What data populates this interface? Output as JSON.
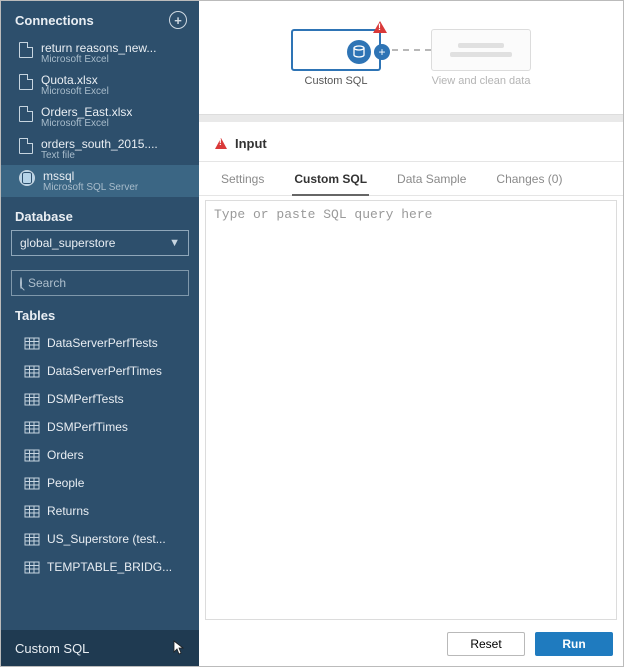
{
  "sidebar": {
    "connections_label": "Connections",
    "connections": [
      {
        "name": "return reasons_new...",
        "sub": "Microsoft Excel",
        "type": "file"
      },
      {
        "name": "Quota.xlsx",
        "sub": "Microsoft Excel",
        "type": "file"
      },
      {
        "name": "Orders_East.xlsx",
        "sub": "Microsoft Excel",
        "type": "file"
      },
      {
        "name": "orders_south_2015....",
        "sub": "Text file",
        "type": "file"
      },
      {
        "name": "mssql",
        "sub": "Microsoft SQL Server",
        "type": "db",
        "selected": true
      }
    ],
    "database_label": "Database",
    "database_value": "global_superstore",
    "search_placeholder": "Search",
    "tables_label": "Tables",
    "tables": [
      "DataServerPerfTests",
      "DataServerPerfTimes",
      "DSMPerfTests",
      "DSMPerfTimes",
      "Orders",
      "People",
      "Returns",
      "US_Superstore (test...",
      "TEMPTABLE_BRIDG..."
    ],
    "custom_sql_label": "Custom SQL"
  },
  "flow": {
    "node_label": "Custom SQL",
    "ghost_label": "View and clean data"
  },
  "panel": {
    "header": "Input",
    "tabs": [
      "Settings",
      "Custom SQL",
      "Data Sample",
      "Changes (0)"
    ],
    "active_tab": 1,
    "sql_placeholder": "Type or paste SQL query here",
    "reset_label": "Reset",
    "run_label": "Run"
  }
}
